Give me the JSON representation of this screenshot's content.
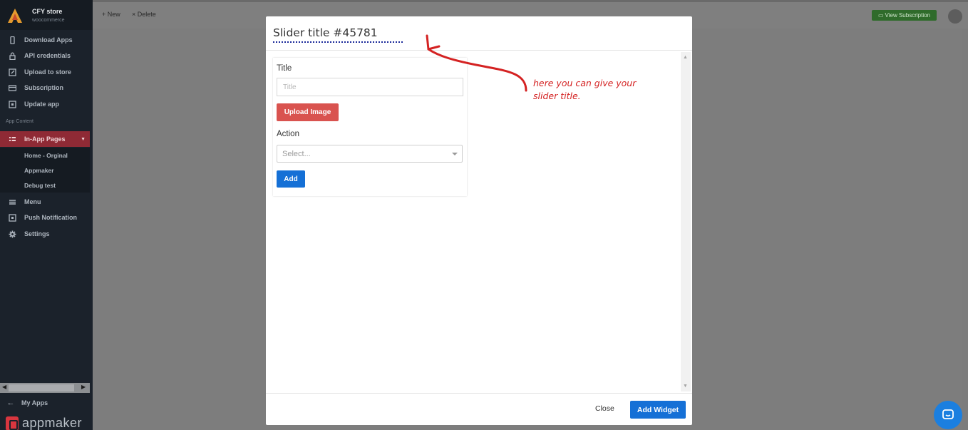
{
  "sidebar": {
    "store_name": "CFY store",
    "store_type": "woocommerce",
    "items": [
      {
        "label": "Download Apps",
        "icon": "phone-icon"
      },
      {
        "label": "API credentials",
        "icon": "lock-icon"
      },
      {
        "label": "Upload to store",
        "icon": "edit-icon"
      },
      {
        "label": "Subscription",
        "icon": "card-icon"
      },
      {
        "label": "Update app",
        "icon": "update-icon"
      }
    ],
    "section_label": "App Content",
    "active_item": {
      "label": "In-App Pages",
      "icon": "grid-icon"
    },
    "sub_items": [
      "Home - Orginal",
      "Appmaker",
      "Debug test"
    ],
    "items_after": [
      {
        "label": "Menu",
        "icon": "list-icon"
      },
      {
        "label": "Push Notification",
        "icon": "bell-icon"
      },
      {
        "label": "Settings",
        "icon": "gear-icon"
      }
    ],
    "my_apps": "My Apps",
    "brand_word": "appmaker"
  },
  "topbar": {
    "new_label": "New",
    "delete_label": "Delete",
    "view_subscription_label": "View Subscription"
  },
  "modal": {
    "title": "Slider title #45781",
    "form": {
      "title_label": "Title",
      "title_placeholder": "Title",
      "upload_label": "Upload Image",
      "action_label": "Action",
      "action_selected": "Select...",
      "add_label": "Add"
    },
    "annotation": "here you can give your slider title.",
    "close_label": "Close",
    "add_widget_label": "Add Widget"
  },
  "colors": {
    "sidebar_bg": "#1b222b",
    "active_bg": "#8f2a35",
    "upload_button": "#d9534f",
    "primary_button": "#1570d6",
    "annotation_red": "#d42222",
    "chat_bubble": "#1b7fe0"
  }
}
